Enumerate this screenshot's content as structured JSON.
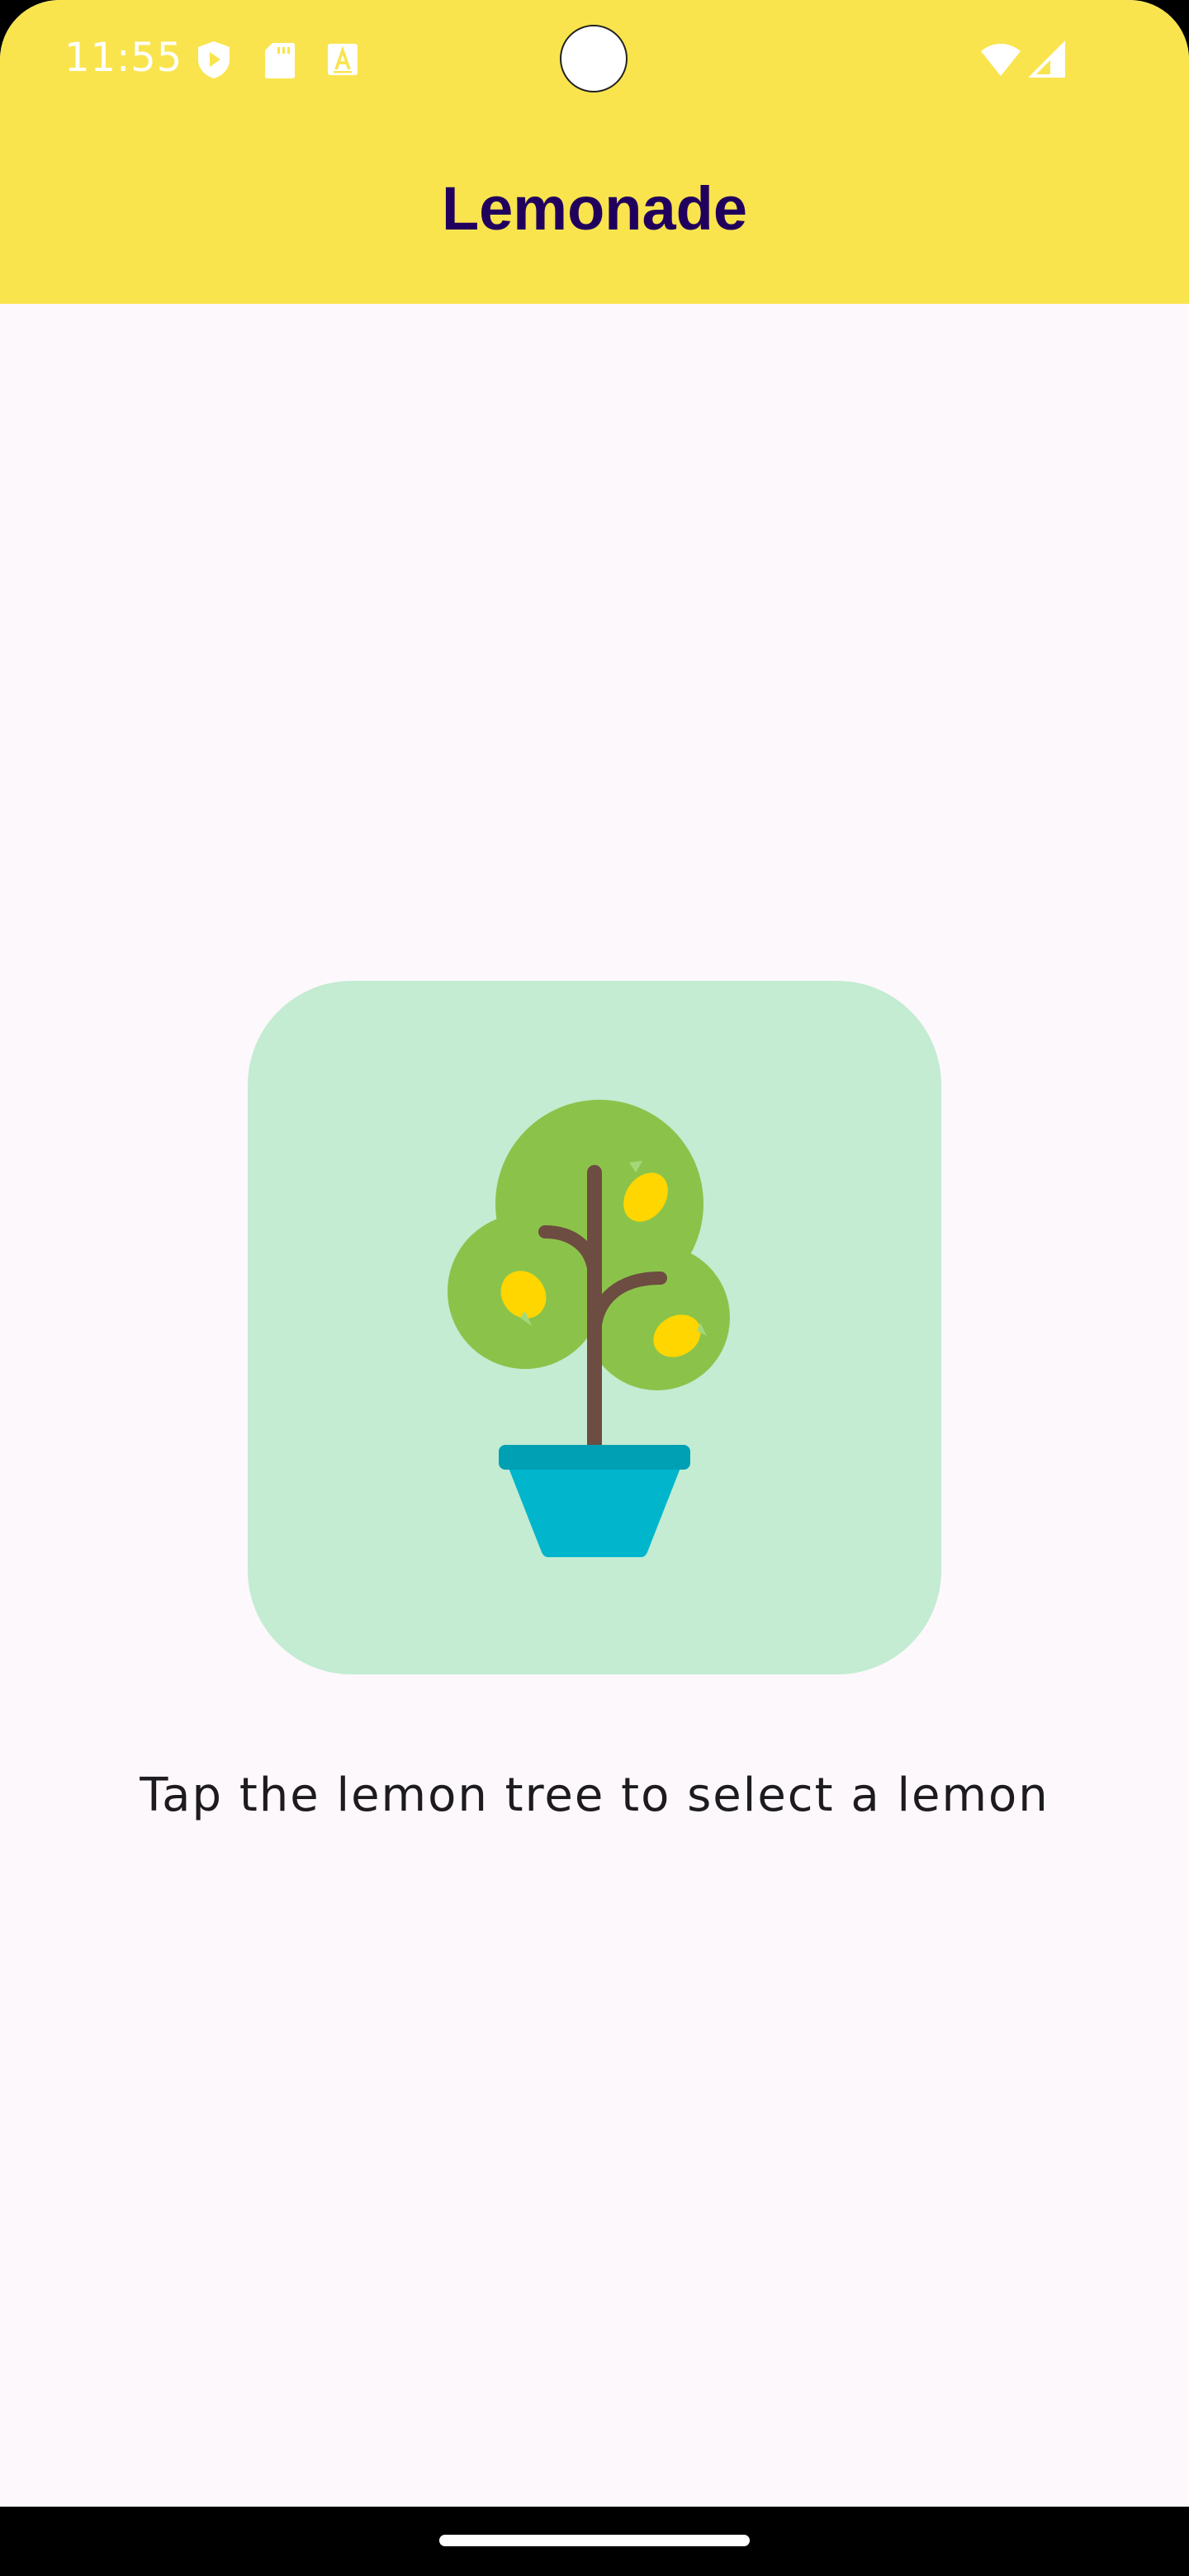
{
  "status_bar": {
    "time": "11:55",
    "left_icons": [
      "shield-play-icon",
      "sd-card-icon",
      "font-a-icon"
    ],
    "right_icons": [
      "wifi-icon",
      "cell-signal-icon"
    ]
  },
  "app_bar": {
    "title": "Lemonade",
    "background_color": "#F9E44E",
    "title_color": "#21005D"
  },
  "main": {
    "image_button": {
      "image": "lemon-tree-icon",
      "background_color": "#C3ECD2"
    },
    "instruction": "Tap the lemon tree to select a lemon"
  },
  "colors": {
    "screen_background": "#FDF8FC",
    "foliage": "#8BC34A",
    "lemon": "#FFD600",
    "trunk": "#6D4C41",
    "pot": "#00B5CC",
    "pot_rim": "#00A0B4"
  }
}
